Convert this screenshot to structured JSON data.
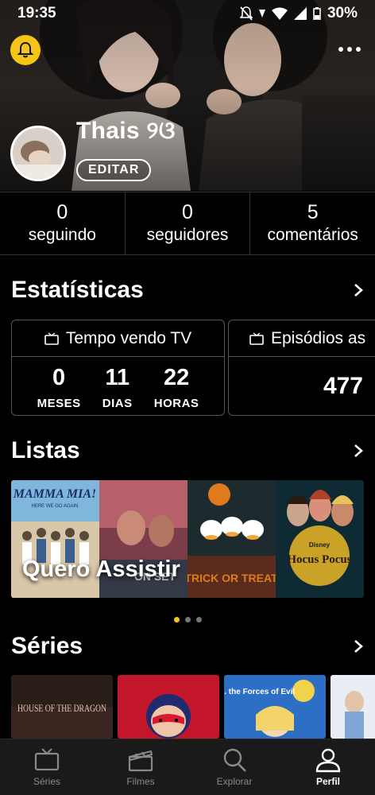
{
  "statusbar": {
    "time": "19:35",
    "battery": "30%"
  },
  "profile": {
    "name": "Thais ୨ଓ",
    "edit_label": "EDITAR"
  },
  "counters": [
    {
      "value": "0",
      "label": "seguindo"
    },
    {
      "value": "0",
      "label": "seguidores"
    },
    {
      "value": "5",
      "label": "comentários"
    }
  ],
  "stats": {
    "title": "Estatísticas",
    "tv_time": {
      "title": "Tempo vendo TV",
      "cells": [
        {
          "value": "0",
          "unit": "MESES"
        },
        {
          "value": "11",
          "unit": "DIAS"
        },
        {
          "value": "22",
          "unit": "HORAS"
        }
      ]
    },
    "episodes": {
      "title": "Episódios as",
      "value": "477"
    }
  },
  "lists": {
    "title": "Listas",
    "current_list": "Quero Assistir",
    "posters": [
      {
        "title": "MAMMA MIA!",
        "subtitle": "HERE WE GO AGAIN"
      },
      {
        "title": "ON SET"
      },
      {
        "title": "TRICK OR TREAT"
      },
      {
        "title": "Hocus Pocus",
        "brand": "Disney"
      }
    ],
    "page_count": 3,
    "active_page": 0
  },
  "series": {
    "title": "Séries",
    "items": [
      {
        "title": "HOUSE OF THE DRAGON"
      },
      {
        "title": ""
      },
      {
        "title": "Star vs. the Forces of Evil"
      },
      {
        "title": ""
      }
    ]
  },
  "nav": [
    {
      "label": "Séries",
      "icon": "tv-icon",
      "active": false
    },
    {
      "label": "Filmes",
      "icon": "clapperboard-icon",
      "active": false
    },
    {
      "label": "Explorar",
      "icon": "search-icon",
      "active": false
    },
    {
      "label": "Perfil",
      "icon": "user-icon",
      "active": true
    }
  ],
  "colors": {
    "accent": "#f5c518",
    "background": "#000000"
  }
}
